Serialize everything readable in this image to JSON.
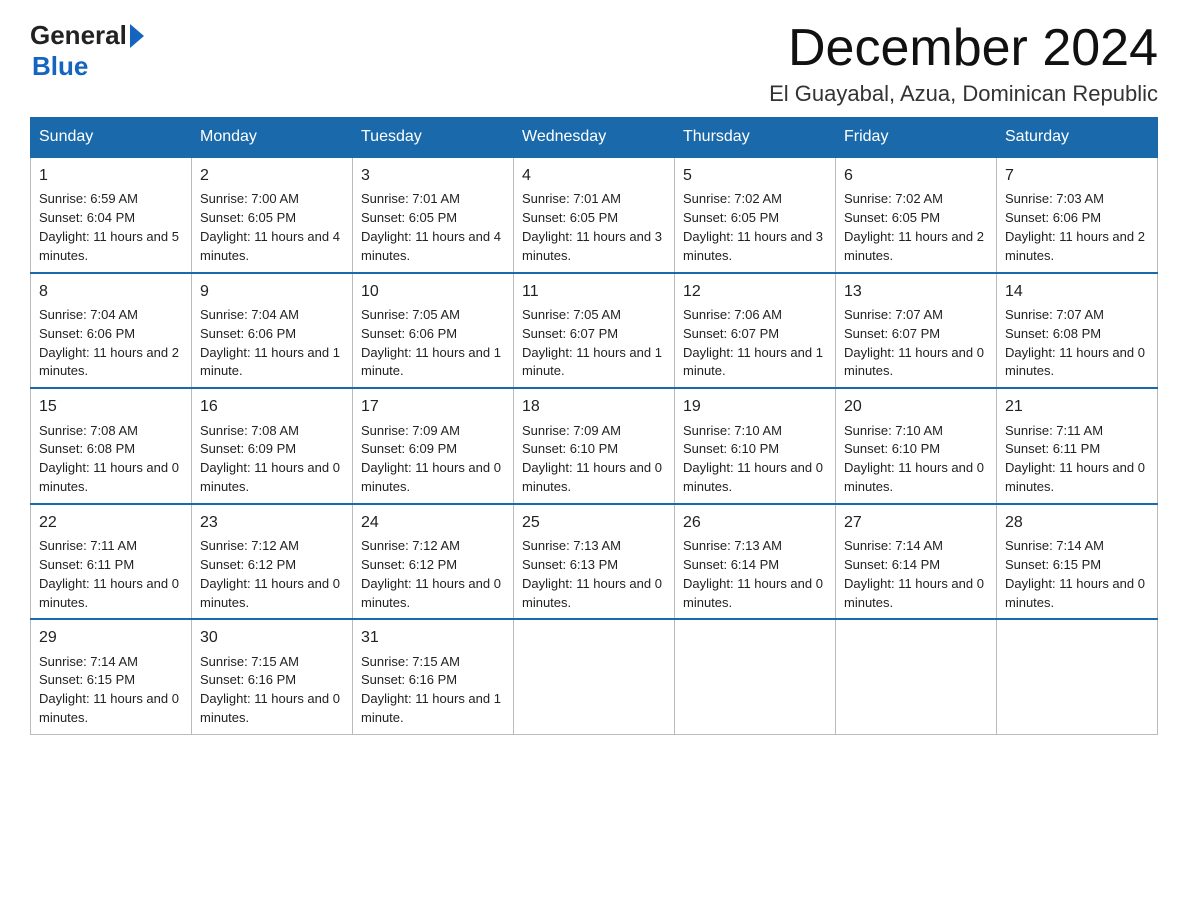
{
  "header": {
    "month_title": "December 2024",
    "location": "El Guayabal, Azua, Dominican Republic",
    "logo_general": "General",
    "logo_blue": "Blue"
  },
  "columns": [
    "Sunday",
    "Monday",
    "Tuesday",
    "Wednesday",
    "Thursday",
    "Friday",
    "Saturday"
  ],
  "weeks": [
    [
      {
        "day": "1",
        "sunrise": "6:59 AM",
        "sunset": "6:04 PM",
        "daylight": "11 hours and 5 minutes."
      },
      {
        "day": "2",
        "sunrise": "7:00 AM",
        "sunset": "6:05 PM",
        "daylight": "11 hours and 4 minutes."
      },
      {
        "day": "3",
        "sunrise": "7:01 AM",
        "sunset": "6:05 PM",
        "daylight": "11 hours and 4 minutes."
      },
      {
        "day": "4",
        "sunrise": "7:01 AM",
        "sunset": "6:05 PM",
        "daylight": "11 hours and 3 minutes."
      },
      {
        "day": "5",
        "sunrise": "7:02 AM",
        "sunset": "6:05 PM",
        "daylight": "11 hours and 3 minutes."
      },
      {
        "day": "6",
        "sunrise": "7:02 AM",
        "sunset": "6:05 PM",
        "daylight": "11 hours and 2 minutes."
      },
      {
        "day": "7",
        "sunrise": "7:03 AM",
        "sunset": "6:06 PM",
        "daylight": "11 hours and 2 minutes."
      }
    ],
    [
      {
        "day": "8",
        "sunrise": "7:04 AM",
        "sunset": "6:06 PM",
        "daylight": "11 hours and 2 minutes."
      },
      {
        "day": "9",
        "sunrise": "7:04 AM",
        "sunset": "6:06 PM",
        "daylight": "11 hours and 1 minute."
      },
      {
        "day": "10",
        "sunrise": "7:05 AM",
        "sunset": "6:06 PM",
        "daylight": "11 hours and 1 minute."
      },
      {
        "day": "11",
        "sunrise": "7:05 AM",
        "sunset": "6:07 PM",
        "daylight": "11 hours and 1 minute."
      },
      {
        "day": "12",
        "sunrise": "7:06 AM",
        "sunset": "6:07 PM",
        "daylight": "11 hours and 1 minute."
      },
      {
        "day": "13",
        "sunrise": "7:07 AM",
        "sunset": "6:07 PM",
        "daylight": "11 hours and 0 minutes."
      },
      {
        "day": "14",
        "sunrise": "7:07 AM",
        "sunset": "6:08 PM",
        "daylight": "11 hours and 0 minutes."
      }
    ],
    [
      {
        "day": "15",
        "sunrise": "7:08 AM",
        "sunset": "6:08 PM",
        "daylight": "11 hours and 0 minutes."
      },
      {
        "day": "16",
        "sunrise": "7:08 AM",
        "sunset": "6:09 PM",
        "daylight": "11 hours and 0 minutes."
      },
      {
        "day": "17",
        "sunrise": "7:09 AM",
        "sunset": "6:09 PM",
        "daylight": "11 hours and 0 minutes."
      },
      {
        "day": "18",
        "sunrise": "7:09 AM",
        "sunset": "6:10 PM",
        "daylight": "11 hours and 0 minutes."
      },
      {
        "day": "19",
        "sunrise": "7:10 AM",
        "sunset": "6:10 PM",
        "daylight": "11 hours and 0 minutes."
      },
      {
        "day": "20",
        "sunrise": "7:10 AM",
        "sunset": "6:10 PM",
        "daylight": "11 hours and 0 minutes."
      },
      {
        "day": "21",
        "sunrise": "7:11 AM",
        "sunset": "6:11 PM",
        "daylight": "11 hours and 0 minutes."
      }
    ],
    [
      {
        "day": "22",
        "sunrise": "7:11 AM",
        "sunset": "6:11 PM",
        "daylight": "11 hours and 0 minutes."
      },
      {
        "day": "23",
        "sunrise": "7:12 AM",
        "sunset": "6:12 PM",
        "daylight": "11 hours and 0 minutes."
      },
      {
        "day": "24",
        "sunrise": "7:12 AM",
        "sunset": "6:12 PM",
        "daylight": "11 hours and 0 minutes."
      },
      {
        "day": "25",
        "sunrise": "7:13 AM",
        "sunset": "6:13 PM",
        "daylight": "11 hours and 0 minutes."
      },
      {
        "day": "26",
        "sunrise": "7:13 AM",
        "sunset": "6:14 PM",
        "daylight": "11 hours and 0 minutes."
      },
      {
        "day": "27",
        "sunrise": "7:14 AM",
        "sunset": "6:14 PM",
        "daylight": "11 hours and 0 minutes."
      },
      {
        "day": "28",
        "sunrise": "7:14 AM",
        "sunset": "6:15 PM",
        "daylight": "11 hours and 0 minutes."
      }
    ],
    [
      {
        "day": "29",
        "sunrise": "7:14 AM",
        "sunset": "6:15 PM",
        "daylight": "11 hours and 0 minutes."
      },
      {
        "day": "30",
        "sunrise": "7:15 AM",
        "sunset": "6:16 PM",
        "daylight": "11 hours and 0 minutes."
      },
      {
        "day": "31",
        "sunrise": "7:15 AM",
        "sunset": "6:16 PM",
        "daylight": "11 hours and 1 minute."
      },
      null,
      null,
      null,
      null
    ]
  ],
  "sunrise_label": "Sunrise:",
  "sunset_label": "Sunset:",
  "daylight_label": "Daylight:"
}
